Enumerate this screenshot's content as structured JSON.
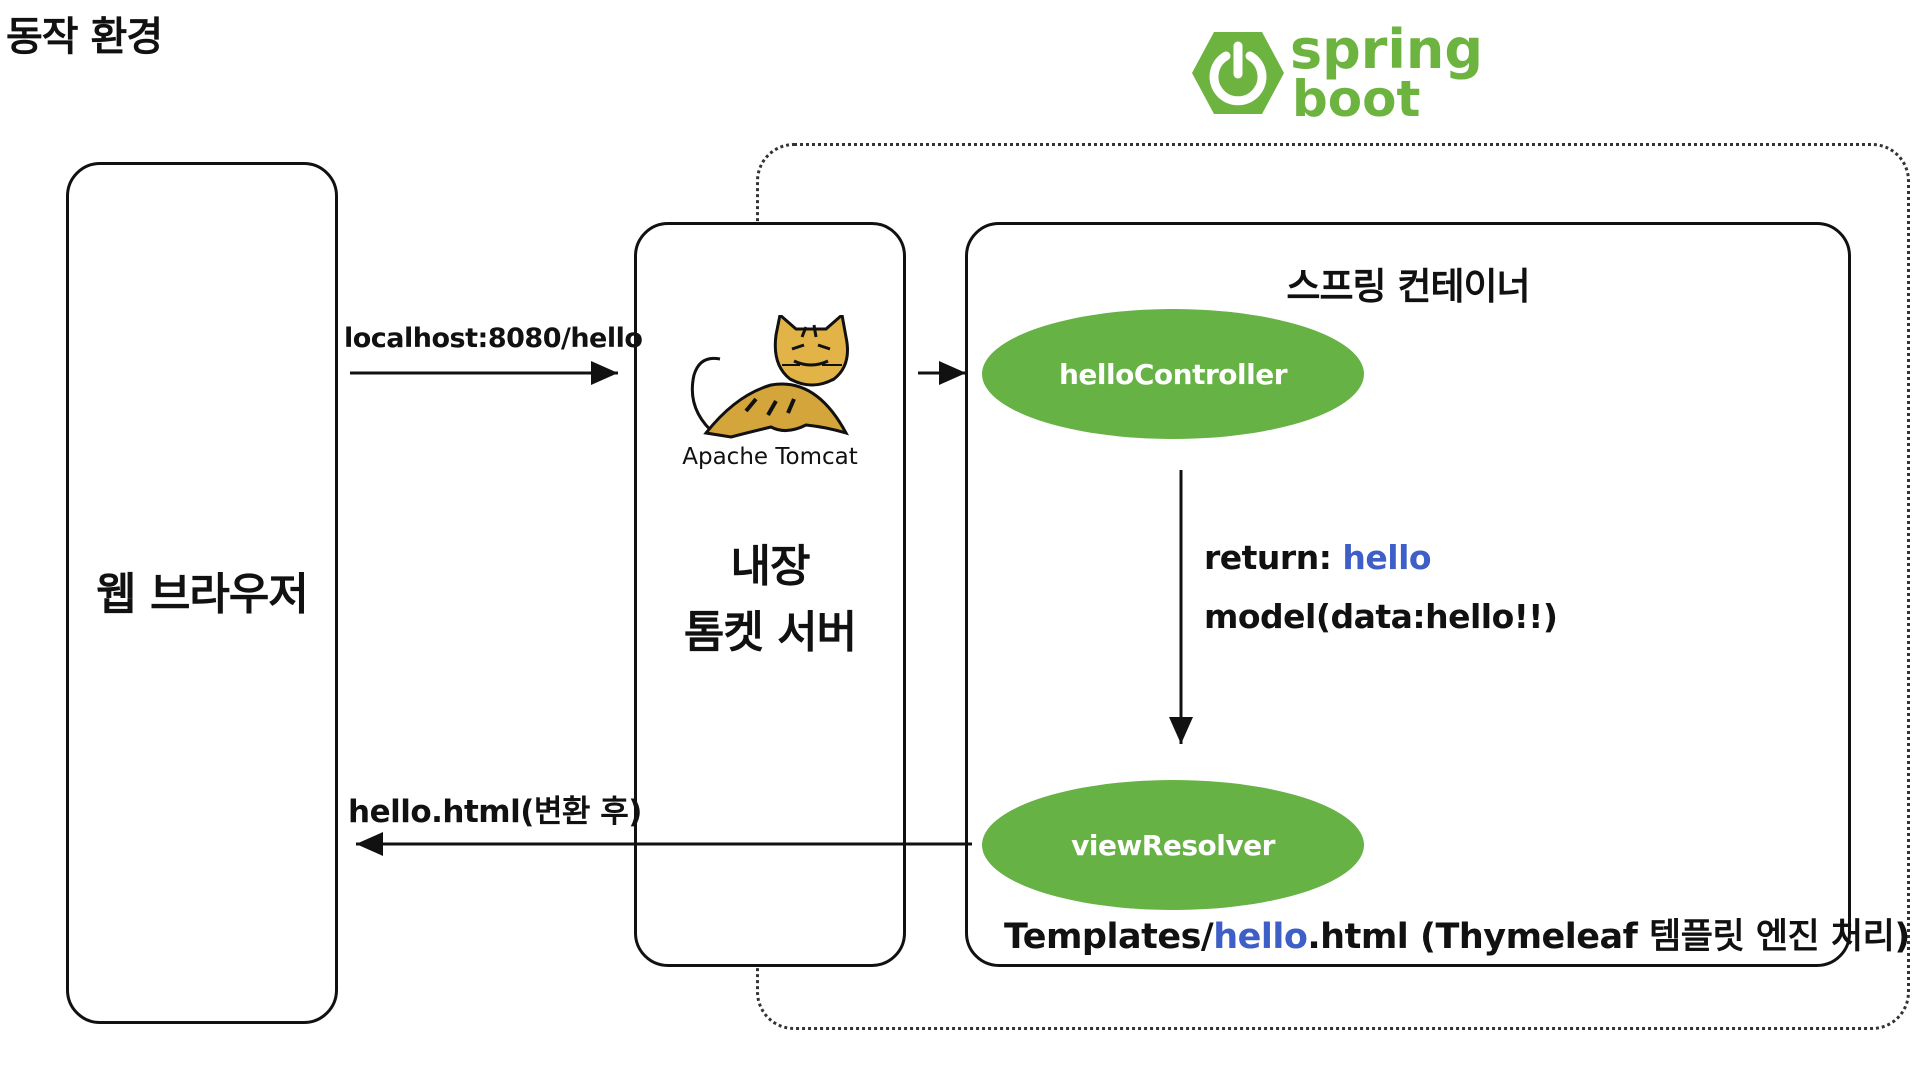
{
  "page_title": "동작 환경",
  "logo": {
    "word_top": "spring",
    "word_bottom": "boot",
    "color": "#6db33f",
    "icon": "power-icon"
  },
  "browser": {
    "label": "웹 브라우저"
  },
  "tomcat": {
    "caption": "Apache Tomcat",
    "label_line1": "내장",
    "label_line2": "톰켓 서버",
    "icon": "tomcat-cat-icon"
  },
  "container": {
    "title": "스프링 컨테이너",
    "controller": "helloController",
    "resolver": "viewResolver",
    "return_prefix": "return: ",
    "return_value": "hello",
    "model_text": "model(data:hello!!)",
    "templates_prefix": "Templates/",
    "templates_highlight": "hello",
    "templates_suffix": ".html (Thymeleaf 템플릿 엔진 처리)"
  },
  "request": {
    "label": "localhost:8080/hello"
  },
  "response": {
    "label": "hello.html(변환 후)"
  },
  "colors": {
    "ellipse": "#66b245",
    "highlight": "#3f5fc8",
    "text": "#111111"
  }
}
